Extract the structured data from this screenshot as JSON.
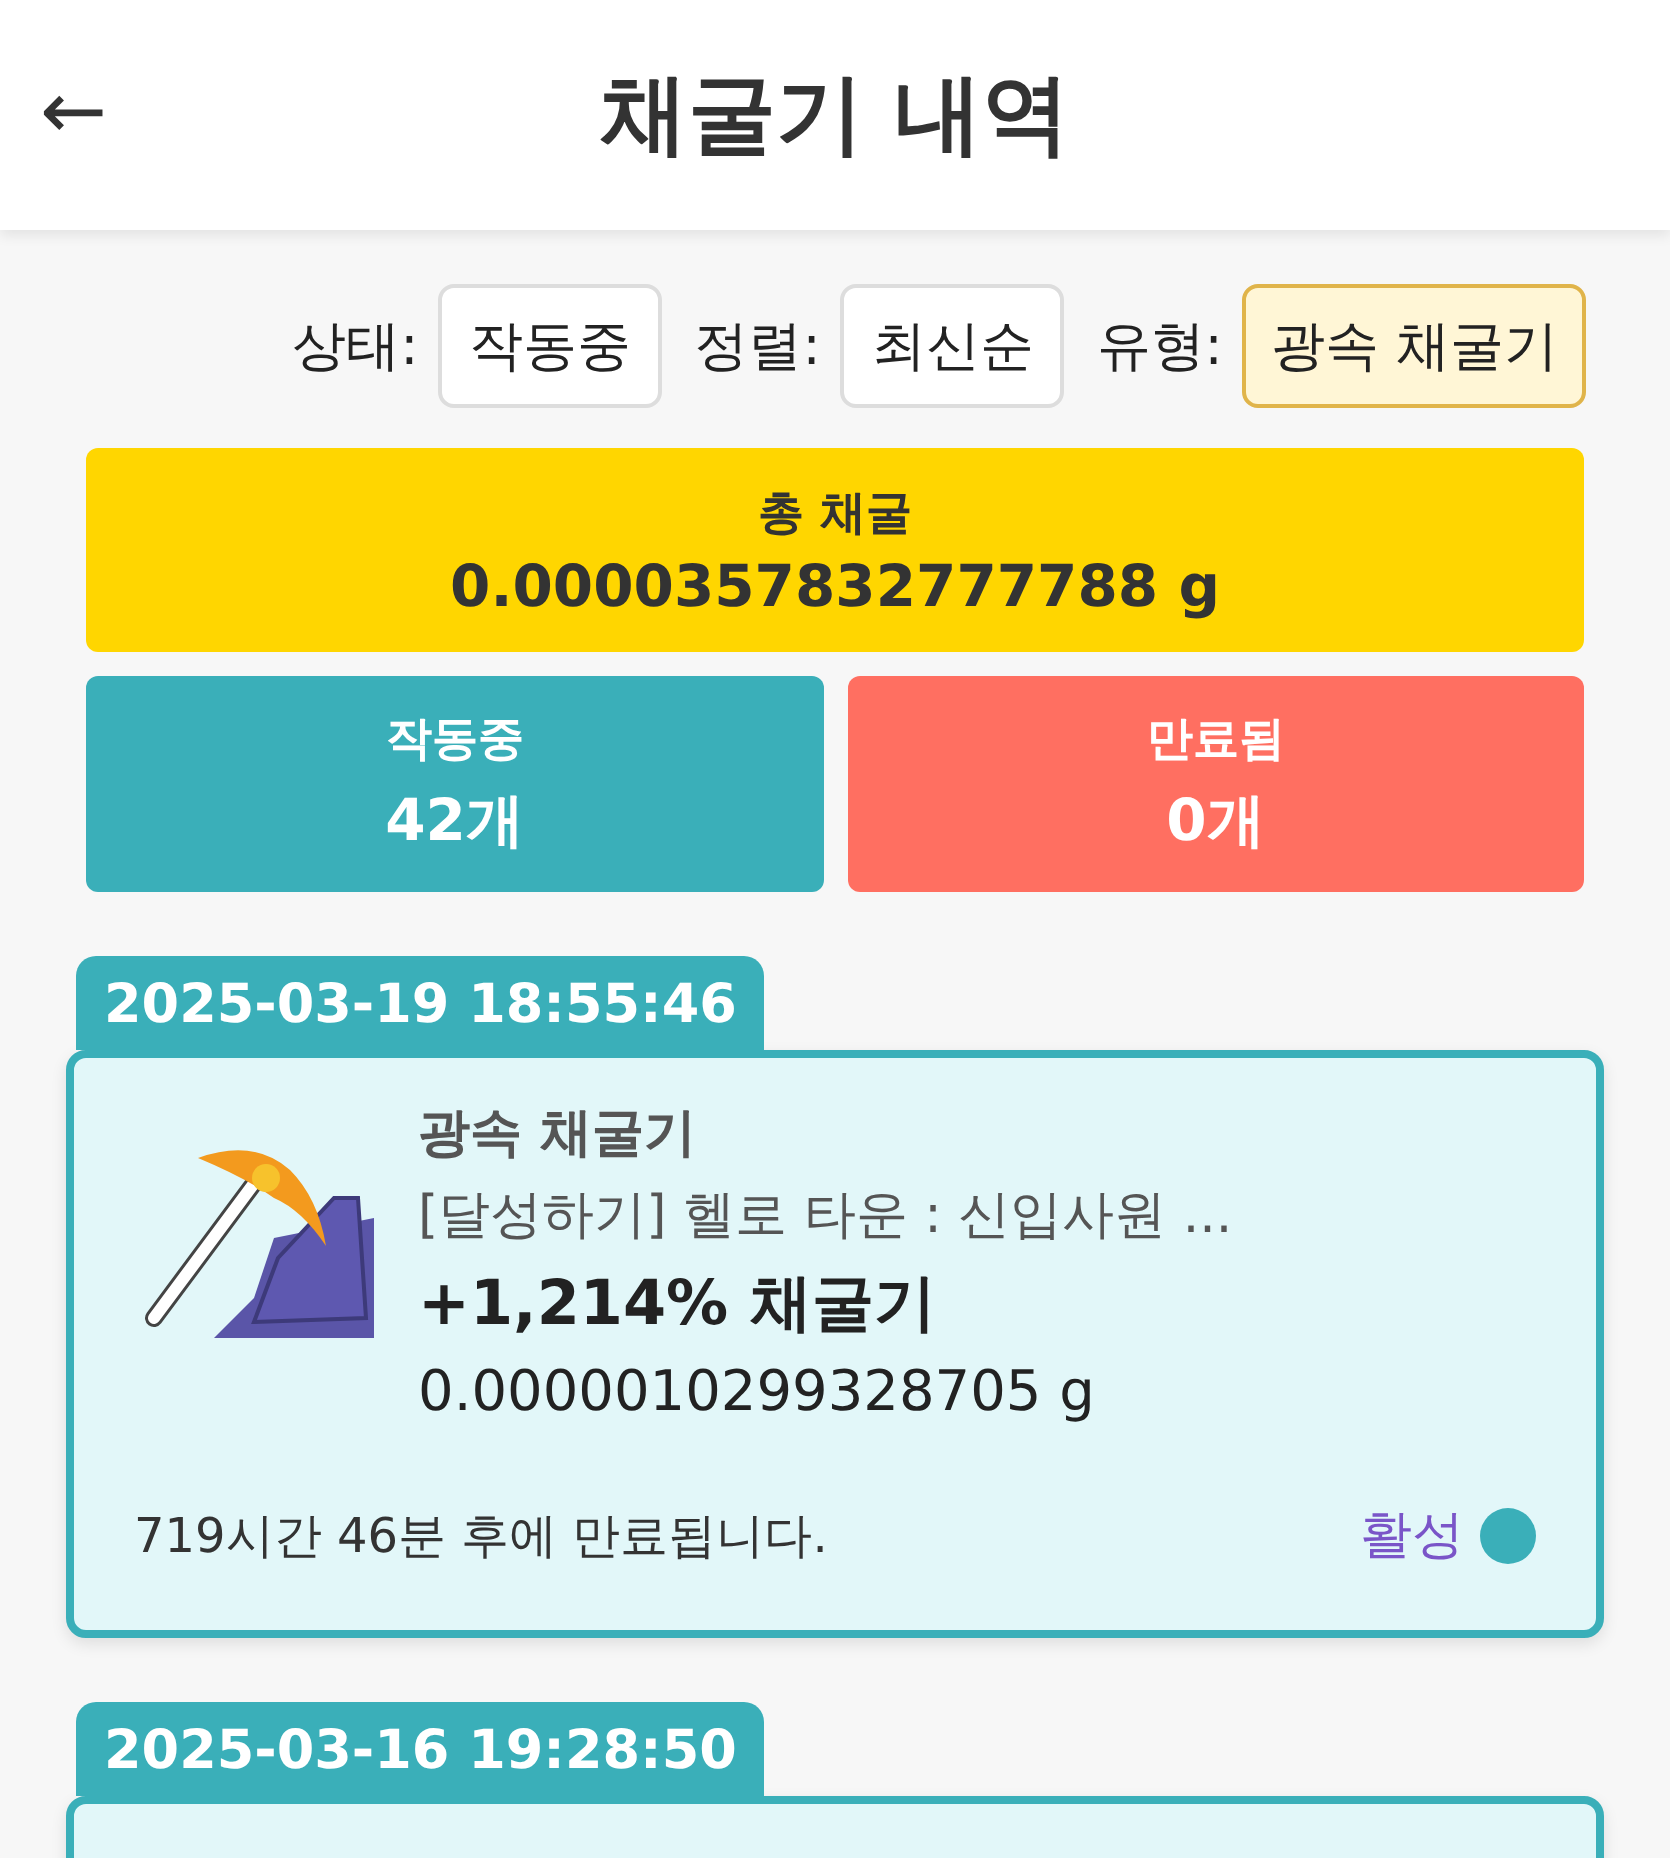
{
  "header": {
    "back": "←",
    "title": "채굴기 내역"
  },
  "filters": [
    {
      "label": "상태:",
      "value": "작동중",
      "highlighted": false
    },
    {
      "label": "정렬:",
      "value": "최신순",
      "highlighted": false
    },
    {
      "label": "유형:",
      "value": "광속 채굴기",
      "highlighted": true
    }
  ],
  "total": {
    "label": "총 채굴",
    "value": "0.0000357832777788 g"
  },
  "stats": [
    {
      "label": "작동중",
      "value": "42개",
      "kind": "active"
    },
    {
      "label": "만료됨",
      "value": "0개",
      "kind": "expired"
    }
  ],
  "records": [
    {
      "date": "2025-03-19 18:55:46",
      "type": "광속 채굴기",
      "source": "[달성하기] 헬로 타운 : 신입사원 ...",
      "boost": "+1,214% 채굴기",
      "amount": "0.0000010299328705 g",
      "expiry": "719시간 46분 후에 만료됩니다.",
      "status": "활성",
      "color": "#3aafb9"
    },
    {
      "date": "2025-03-16 19:28:50"
    }
  ]
}
